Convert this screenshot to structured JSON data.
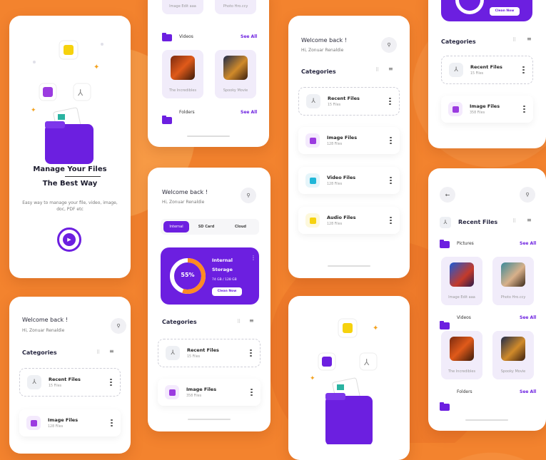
{
  "onboarding": {
    "headline1": "Manage Your Files",
    "headline2": "The Best Way",
    "body": "Easy way to manage your file, video, image, doc, PDF etc"
  },
  "common": {
    "welcome": "Welcome back !",
    "user": "Hi, Zonuar Renaldie",
    "categories": "Categories",
    "see_all": "See All"
  },
  "files": {
    "recent": {
      "title": "Recent Files",
      "sub": "15 Files"
    },
    "image": {
      "title": "Image Files",
      "sub": "128 Files"
    },
    "image_alt": {
      "sub": "358 Files"
    },
    "video": {
      "title": "Video Files",
      "sub": "128 Files"
    },
    "audio": {
      "title": "Audio Files",
      "sub": "128 Files"
    }
  },
  "storage": {
    "tabs": [
      "Internal",
      "SD Card",
      "Cloud"
    ],
    "percent": "55%",
    "label1": "Internal",
    "label2": "Storage",
    "amount": "74 GB / 128 GB",
    "button": "Clean Now"
  },
  "sections": {
    "pictures": "Pictures",
    "videos": "Videos",
    "folders": "Folders"
  },
  "thumbs": {
    "pic1": "Image Edit aaa",
    "pic2": "Photo Hro.ccy",
    "vid1": "The Incredibles",
    "vid2": "Spooky Movie"
  },
  "recent_header": "Recent Files",
  "colors": {
    "accent": "#6c1fe0",
    "background": "#f3832e"
  }
}
